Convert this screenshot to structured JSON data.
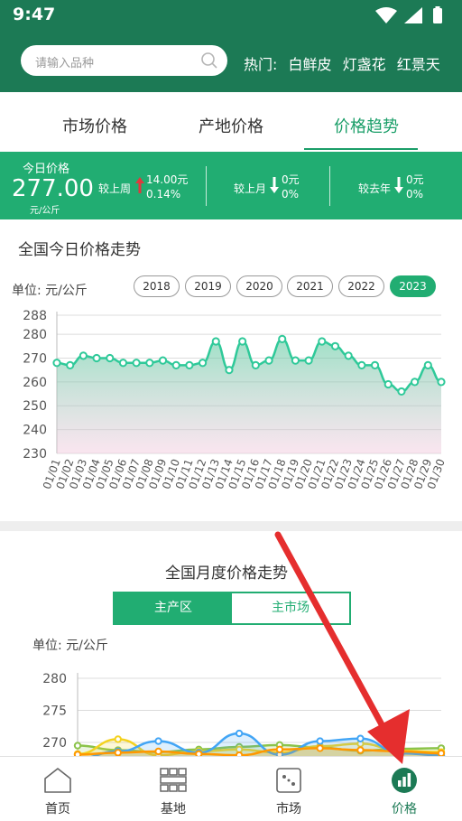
{
  "status": {
    "time": "9:47"
  },
  "search": {
    "placeholder": "请输入品种"
  },
  "hot": {
    "label": "热门:",
    "items": [
      "白鲜皮",
      "灯盏花",
      "红景天"
    ]
  },
  "tabs": [
    {
      "label": "市场价格",
      "active": false
    },
    {
      "label": "产地价格",
      "active": false
    },
    {
      "label": "价格趋势",
      "active": true
    }
  ],
  "today": {
    "label": "今日价格",
    "price": "277.00",
    "unit": "元/公斤",
    "week": {
      "label": "较上周",
      "direction": "up",
      "amount": "14.00元",
      "percent": "0.14%"
    },
    "month": {
      "label": "较上月",
      "direction": "down",
      "amount": "0元",
      "percent": "0%"
    },
    "year": {
      "label": "较去年",
      "direction": "down",
      "amount": "0元",
      "percent": "0%"
    }
  },
  "section1": {
    "title": "全国今日价格走势",
    "unit": "单位: 元/公斤",
    "years": [
      "2018",
      "2019",
      "2020",
      "2021",
      "2022",
      "2023"
    ],
    "active_year": "2023"
  },
  "section2": {
    "title": "全国月度价格走势",
    "segments": [
      "主产区",
      "主市场"
    ],
    "active_segment": "主产区",
    "unit": "单位: 元/公斤"
  },
  "nav": [
    {
      "label": "首页",
      "icon": "home-icon",
      "active": false
    },
    {
      "label": "基地",
      "icon": "grid-icon",
      "active": false
    },
    {
      "label": "市场",
      "icon": "market-icon",
      "active": false
    },
    {
      "label": "价格",
      "icon": "bar-chart-icon",
      "active": true
    }
  ],
  "colors": {
    "header": "#1c7a55",
    "accent": "#21ad72",
    "line": "#2fc999",
    "up": "#e0383e",
    "annotation_arrow": "#e52e2e"
  },
  "chart_data": [
    {
      "type": "area",
      "title": "",
      "ylabel": "",
      "ylim": [
        230,
        288
      ],
      "yticks": [
        230,
        240,
        250,
        260,
        270,
        280,
        288
      ],
      "grid": true,
      "x": [
        "01/01",
        "01/02",
        "01/03",
        "01/04",
        "01/05",
        "01/06",
        "01/07",
        "01/08",
        "01/09",
        "01/10",
        "01/11",
        "01/12",
        "01/13",
        "01/14",
        "01/15",
        "01/16",
        "01/17",
        "01/18",
        "01/19",
        "01/20",
        "01/21",
        "01/22",
        "01/23",
        "01/24",
        "01/25",
        "01/26",
        "01/27",
        "01/28",
        "01/29",
        "01/30"
      ],
      "series": [
        {
          "values": [
            268,
            267,
            271,
            270,
            270,
            268,
            268,
            268,
            269,
            267,
            267,
            268,
            277,
            265,
            277,
            267,
            269,
            278,
            269,
            269,
            277,
            275,
            271,
            267,
            267,
            259,
            256,
            260,
            267,
            260
          ]
        }
      ]
    },
    {
      "type": "line",
      "title": "",
      "ylabel": "",
      "ylim": [
        267,
        282
      ],
      "yticks": [
        270,
        275,
        280
      ],
      "grid": true,
      "series": [
        {
          "color": "#8bc34a",
          "values": [
            269.5,
            268.8,
            268.5,
            268.9,
            269.3,
            269.6,
            269.2,
            268.7,
            269.0,
            269.1
          ]
        },
        {
          "color": "#f4d21f",
          "values": [
            268.2,
            270.5,
            268.0,
            268.6,
            268.9,
            268.4,
            269.4,
            269.8,
            268.7,
            268.5
          ]
        },
        {
          "color": "#42a5f5",
          "values": [
            267.5,
            268.6,
            270.2,
            268.4,
            271.4,
            268.1,
            270.2,
            270.6,
            268.3,
            268.0
          ]
        },
        {
          "color": "#ff9800",
          "values": [
            268.1,
            268.4,
            268.6,
            268.2,
            268.0,
            268.9,
            269.1,
            268.8,
            268.6,
            268.3
          ]
        }
      ]
    }
  ]
}
